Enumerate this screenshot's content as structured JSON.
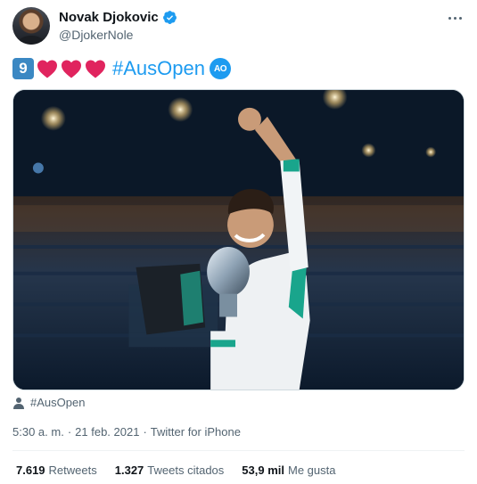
{
  "author": {
    "name": "Novak Djokovic",
    "handle": "@DjokerNole",
    "verified": true
  },
  "tweet": {
    "keycap_number": "9",
    "hearts": 3,
    "hashtag": "#AusOpen",
    "ao_badge": "AO"
  },
  "media": {
    "alt_label": "#AusOpen"
  },
  "meta": {
    "time": "5:30 a. m.",
    "separator": "·",
    "date": "21 feb. 2021",
    "source": "Twitter for iPhone"
  },
  "stats": {
    "retweets": {
      "count": "7.619",
      "label": "Retweets"
    },
    "quotes": {
      "count": "1.327",
      "label": "Tweets citados"
    },
    "likes": {
      "count": "53,9 mil",
      "label": "Me gusta"
    }
  },
  "colors": {
    "accent": "#1d9bf0",
    "heart": "#e0245e",
    "keycap": "#3b88c3",
    "secondary_text": "#536471"
  }
}
